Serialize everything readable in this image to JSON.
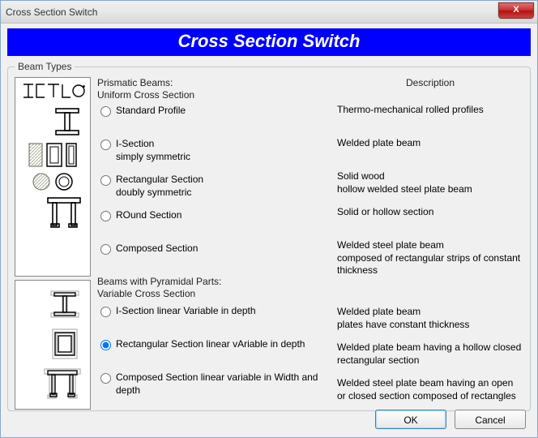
{
  "window_title": "Cross Section Switch",
  "banner": "Cross Section Switch",
  "groupbox_label": "Beam Types",
  "prismatic_header_line1": "Prismatic Beams:",
  "prismatic_header_line2": "Uniform Cross Section",
  "description_header": "Description",
  "options": [
    {
      "label": "Standard Profile",
      "desc": "Thermo-mechanical rolled profiles",
      "checked": false
    },
    {
      "label": "I-Section\nsimply symmetric",
      "desc": "Welded plate beam",
      "checked": false
    },
    {
      "label": "Rectangular Section\n doubly symmetric",
      "desc": "Solid wood\nhollow welded steel plate beam",
      "checked": false
    },
    {
      "label": "ROund Section",
      "desc": "Solid or hollow section",
      "checked": false
    },
    {
      "label": "Composed Section",
      "desc": "Welded steel plate beam\ncomposed of rectangular strips of constant thickness",
      "checked": false
    }
  ],
  "variable_header_line1": "Beams with Pyramidal Parts:",
  "variable_header_line2": "Variable Cross Section",
  "var_options": [
    {
      "label": "I-Section linear Variable in depth",
      "desc": "Welded plate beam\nplates have constant thickness",
      "checked": false
    },
    {
      "label": "Rectangular Section linear vAriable in depth",
      "desc": "Welded plate beam having a hollow closed rectangular section",
      "checked": true
    },
    {
      "label": "Composed Section linear variable in Width and depth",
      "desc": "Welded steel plate beam having an open or closed section composed of rectangles",
      "checked": false
    }
  ],
  "ok_label": "OK",
  "cancel_label": "Cancel",
  "close_glyph": "X"
}
